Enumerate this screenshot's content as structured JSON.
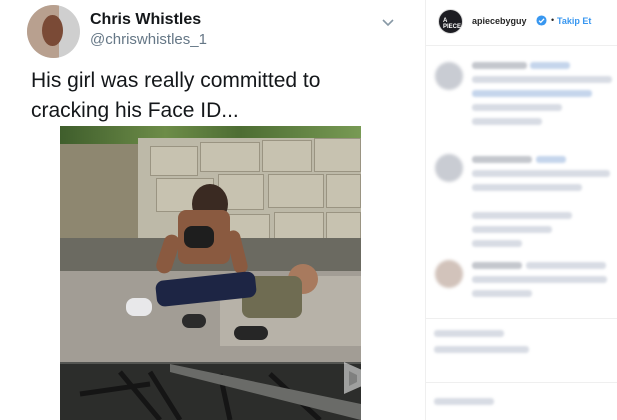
{
  "tweet": {
    "display_name": "Chris Whistles",
    "handle": "@chriswhistles_1",
    "text": "His girl was really committed to cracking his Face ID..."
  },
  "instagram": {
    "username": "apiecebyguy",
    "separator": "•",
    "follow_label": "Takip Et",
    "avatar_text": "A PIECE",
    "accent_color": "#3897f0",
    "verified_icon": "verified-badge-icon"
  },
  "colors": {
    "tweet_text": "#14171a",
    "handle": "#657786"
  }
}
